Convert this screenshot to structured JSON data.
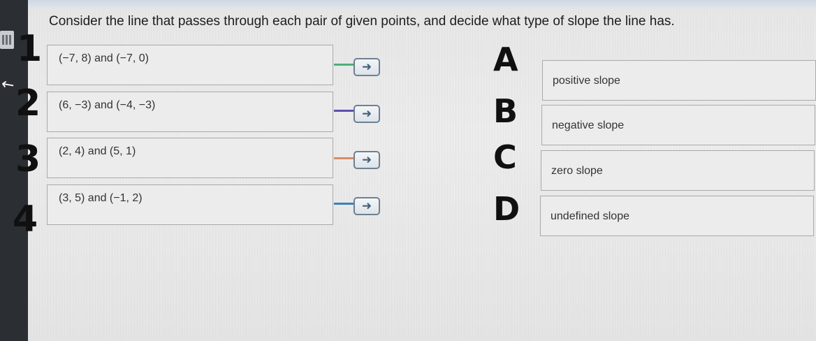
{
  "prompt": "Consider the line that passes through each pair of given points, and decide what type of slope the line has.",
  "questions": [
    {
      "number": "1",
      "text": "(−7, 8) and (−7, 0)",
      "connector_color": "#4caf7a"
    },
    {
      "number": "2",
      "text": "(6, −3) and (−4, −3)",
      "connector_color": "#5b4fb0"
    },
    {
      "number": "3",
      "text": "(2, 4) and (5, 1)",
      "connector_color": "#d98a6a"
    },
    {
      "number": "4",
      "text": "(3, 5) and (−1, 2)",
      "connector_color": "#3f7fb5"
    }
  ],
  "arrow_glyph": "➜",
  "answers": [
    {
      "letter": "A",
      "text": "positive slope"
    },
    {
      "letter": "B",
      "text": "negative slope"
    },
    {
      "letter": "C",
      "text": "zero slope"
    },
    {
      "letter": "D",
      "text": "undefined slope"
    }
  ],
  "icons": {
    "sidebar_tool": "calculator-icon",
    "pointer": "cursor-icon",
    "match_button": "arrow-right-icon"
  }
}
